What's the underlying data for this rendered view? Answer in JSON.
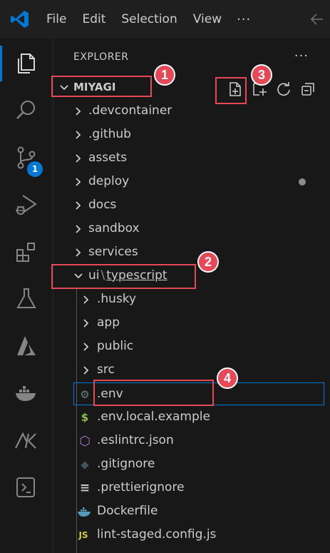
{
  "menu": {
    "file": "File",
    "edit": "Edit",
    "selection": "Selection",
    "view": "View",
    "more": "···"
  },
  "activity_bar": {
    "items": [
      "explorer-icon",
      "search-icon",
      "source-control-icon",
      "run-debug-icon",
      "extensions-icon",
      "testing-icon",
      "azure-icon",
      "docker-icon",
      "kubernetes-icon",
      "remote-explorer-icon"
    ],
    "source_control_badge": "1",
    "accent": "#0078d4"
  },
  "explorer": {
    "title": "EXPLORER",
    "more": "···",
    "root": "MIYAGI",
    "root_actions": [
      "new-file-icon",
      "new-folder-icon",
      "refresh-icon",
      "collapse-all-icon"
    ],
    "tree": [
      {
        "label": ".devcontainer",
        "kind": "folder"
      },
      {
        "label": ".github",
        "kind": "folder"
      },
      {
        "label": "assets",
        "kind": "folder"
      },
      {
        "label": "deploy",
        "kind": "folder",
        "modified": true
      },
      {
        "label": "docs",
        "kind": "folder"
      },
      {
        "label": "sandbox",
        "kind": "folder"
      },
      {
        "label": "services",
        "kind": "folder"
      }
    ],
    "open_folder": {
      "part1": "ui",
      "sep": "\\",
      "part2": "typescript"
    },
    "children": [
      {
        "label": ".husky",
        "kind": "folder"
      },
      {
        "label": "app",
        "kind": "folder"
      },
      {
        "label": "public",
        "kind": "folder"
      },
      {
        "label": "src",
        "kind": "folder"
      },
      {
        "label": ".env",
        "kind": "file",
        "icon": "gear-icon",
        "icon_glyph": "⚙",
        "icon_color": "#6d8086",
        "selected": true
      },
      {
        "label": ".env.local.example",
        "kind": "file",
        "icon": "dollar-icon",
        "icon_glyph": "$",
        "icon_color": "#8dc149"
      },
      {
        "label": ".eslintrc.json",
        "kind": "file",
        "icon": "eslint-icon",
        "icon_glyph": "⬡",
        "icon_color": "#a074c4"
      },
      {
        "label": ".gitignore",
        "kind": "file",
        "icon": "git-icon",
        "icon_glyph": "◆",
        "icon_color": "#41535b"
      },
      {
        "label": ".prettierignore",
        "kind": "file",
        "icon": "lines-icon",
        "icon_glyph": "≡",
        "icon_color": "#cccccc"
      },
      {
        "label": "Dockerfile",
        "kind": "file",
        "icon": "docker-file-icon",
        "icon_glyph": "🐳",
        "icon_color": "#519aba"
      },
      {
        "label": "lint-staged.config.js",
        "kind": "file",
        "icon": "js-icon",
        "icon_glyph": "JS",
        "icon_color": "#cbcb41"
      }
    ]
  },
  "callouts": [
    "1",
    "2",
    "3",
    "4"
  ],
  "callout_color": "#e74856"
}
